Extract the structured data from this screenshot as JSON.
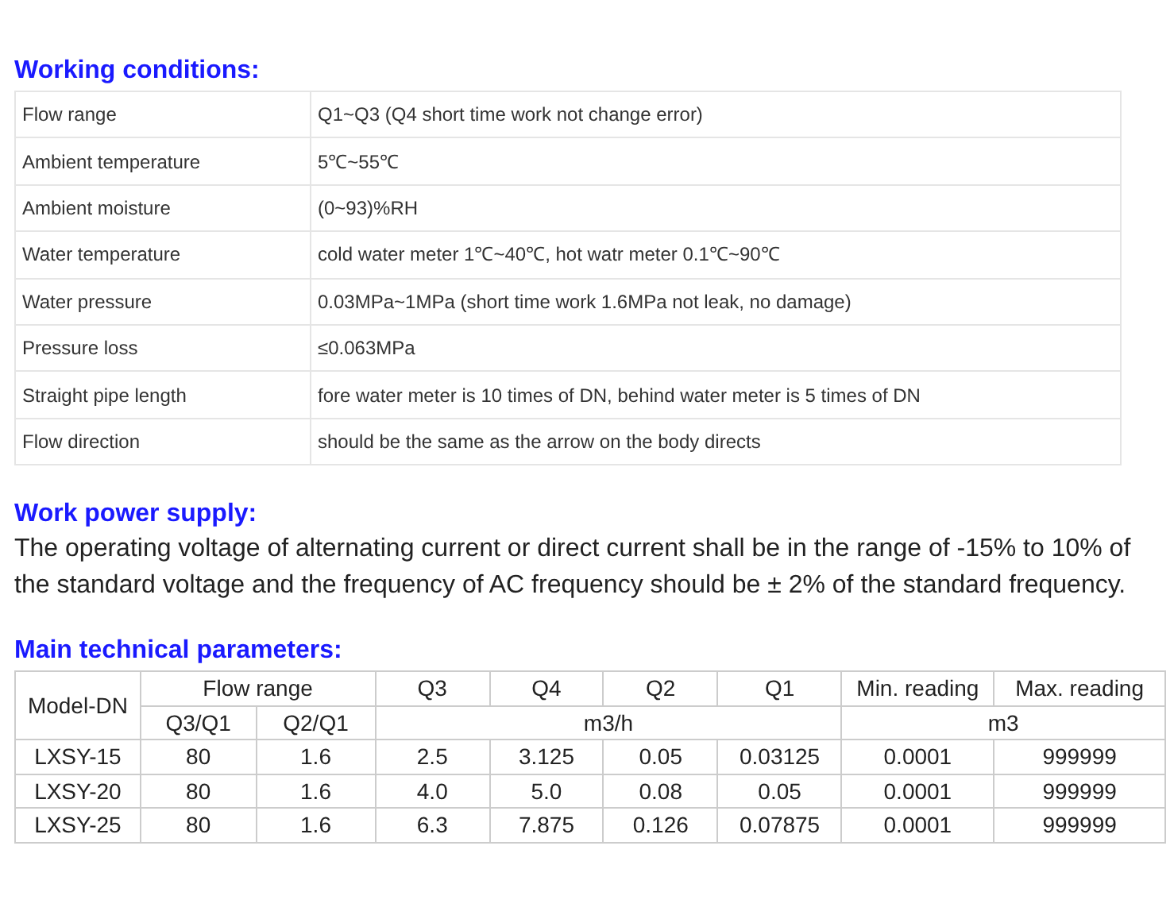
{
  "working_conditions": {
    "heading": "Working conditions:",
    "rows": [
      {
        "label": "Flow range",
        "value": "Q1~Q3 (Q4 short time work not change error)"
      },
      {
        "label": "Ambient temperature",
        "value": "5℃~55℃"
      },
      {
        "label": "Ambient moisture",
        "value": "(0~93)%RH"
      },
      {
        "label": "Water temperature",
        "value": "cold water meter 1℃~40℃, hot watr meter 0.1℃~90℃"
      },
      {
        "label": "Water pressure",
        "value": "0.03MPa~1MPa (short time work 1.6MPa not leak, no damage)"
      },
      {
        "label": "Pressure loss",
        "value": "≤0.063MPa"
      },
      {
        "label": "Straight pipe length",
        "value": "fore water meter is 10 times of DN, behind water meter is 5 times of DN"
      },
      {
        "label": "Flow direction",
        "value": "should be the same as the arrow on the body directs"
      }
    ]
  },
  "work_power_supply": {
    "heading": "Work power supply:",
    "text": "The operating voltage of alternating current or direct current shall be in the range of -15% to 10% of the standard voltage and the frequency of AC frequency should be ± 2% of the standard frequency."
  },
  "main_technical_parameters": {
    "heading": "Main technical parameters:",
    "header_row_1": [
      "Model-DN",
      "Flow range",
      "Q3",
      "Q4",
      "Q2",
      "Q1",
      "Min. reading",
      "Max. reading"
    ],
    "header_row_2": [
      "Q3/Q1",
      "Q2/Q1",
      "m3/h",
      "m3"
    ],
    "rows": [
      [
        "LXSY-15",
        "80",
        "1.6",
        "2.5",
        "3.125",
        "0.05",
        "0.03125",
        "0.0001",
        "999999"
      ],
      [
        "LXSY-20",
        "80",
        "1.6",
        "4.0",
        "5.0",
        "0.08",
        "0.05",
        "0.0001",
        "999999"
      ],
      [
        "LXSY-25",
        "80",
        "1.6",
        "6.3",
        "7.875",
        "0.126",
        "0.07875",
        "0.0001",
        "999999"
      ]
    ]
  }
}
